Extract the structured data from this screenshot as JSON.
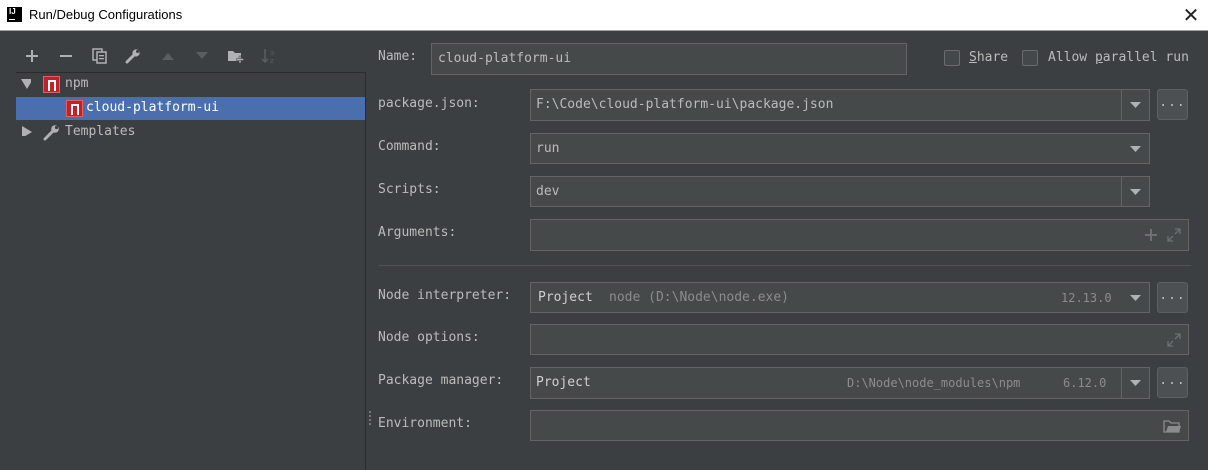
{
  "window": {
    "title": "Run/Debug Configurations",
    "app_icon_text": "IJ",
    "close_glyph": "✕"
  },
  "toolbar": {
    "buttons": [
      "add-icon",
      "remove-icon",
      "copy-icon",
      "wrench-icon",
      "move-up-icon",
      "move-down-icon",
      "new-folder-icon",
      "sort-icon"
    ]
  },
  "tree": {
    "root_label": "npm",
    "child_label": "cloud-platform-ui",
    "templates_label": "Templates"
  },
  "form": {
    "name_label": "Name:",
    "name_value": "cloud-platform-ui",
    "share_label": "Share",
    "parallel_label": "Allow parallel run",
    "package_json_label": "package.json:",
    "package_json_value": "F:\\Code\\cloud-platform-ui\\package.json",
    "command_label": "Command:",
    "command_value": "run",
    "scripts_label": "Scripts:",
    "scripts_value": "dev",
    "arguments_label": "Arguments:",
    "arguments_value": "",
    "node_interpreter_label": "Node interpreter:",
    "node_interpreter_value": "Project",
    "node_interpreter_path": "node (D:\\Node\\node.exe)",
    "node_interpreter_version": "12.13.0",
    "node_options_label": "Node options:",
    "node_options_value": "",
    "package_manager_label": "Package manager:",
    "package_manager_value": "Project",
    "package_manager_path": "D:\\Node\\node_modules\\npm",
    "package_manager_version": "6.12.0",
    "environment_label": "Environment:",
    "environment_value": "",
    "browse_label": "..."
  },
  "colors": {
    "background": "#3c3f41",
    "field_bg": "#45494a",
    "selection": "#4b6eaf",
    "npm_red": "#c12127"
  }
}
